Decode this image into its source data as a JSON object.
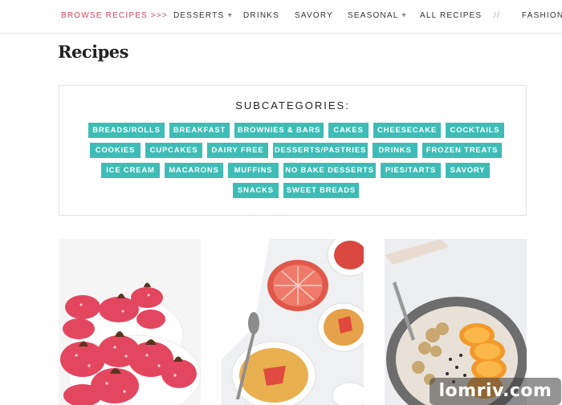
{
  "nav": {
    "items": [
      {
        "label": "BROWSE RECIPES >>>",
        "active": true
      },
      {
        "label": "DESSERTS +"
      },
      {
        "label": "DRINKS"
      },
      {
        "label": "SAVORY"
      },
      {
        "label": "SEASONAL +"
      },
      {
        "label": "ALL RECIPES"
      },
      {
        "label": "//"
      },
      {
        "label": "FASHION"
      }
    ]
  },
  "page": {
    "title": "Recipes"
  },
  "subcategories": {
    "title": "SUBCATEGORIES:",
    "tags": [
      "BREADS/ROLLS",
      "BREAKFAST",
      "BROWNIES & BARS",
      "CAKES",
      "CHEESECAKE",
      "COCKTAILS",
      "COOKIES",
      "CUPCAKES",
      "DAIRY FREE",
      "DESSERTS/PASTRIES",
      "DRINKS",
      "FROZEN TREATS",
      "ICE CREAM",
      "MACARONS",
      "MUFFINS",
      "NO BAKE DESSERTS",
      "PIES/TARTS",
      "SAVORY",
      "SNACKS",
      "SWEET BREADS"
    ]
  },
  "photos": [
    {
      "icon": "cookies-photo"
    },
    {
      "icon": "grapefruit-creme-brulee-photo"
    },
    {
      "icon": "smoothie-bowl-photo"
    }
  ],
  "watermark": {
    "text": "lomriv.com"
  },
  "colors": {
    "accent": "#d2455f",
    "tag": "#3dbdb6"
  }
}
